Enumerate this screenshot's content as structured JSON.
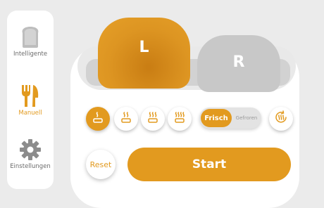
{
  "colors": {
    "accent": "#e29a1f",
    "inactive_bread": "#c8c8c8",
    "background": "#ebebeb",
    "icon_gray": "#8c8c8c"
  },
  "sidebar": {
    "items": [
      {
        "label": "Intelligente",
        "icon": "bread-slice-icon",
        "active": false
      },
      {
        "label": "Manuell",
        "icon": "fork-knife-icon",
        "active": true
      },
      {
        "label": "Einstellungen",
        "icon": "gear-icon",
        "active": false
      }
    ]
  },
  "slots": {
    "left": {
      "label": "L",
      "active": true
    },
    "right": {
      "label": "R",
      "active": false
    }
  },
  "browning_levels": [
    {
      "level": 1,
      "icon": "toast-level-1-icon",
      "selected": true
    },
    {
      "level": 2,
      "icon": "toast-level-2-icon",
      "selected": false
    },
    {
      "level": 3,
      "icon": "toast-level-3-icon",
      "selected": false
    },
    {
      "level": 4,
      "icon": "toast-level-4-icon",
      "selected": false
    }
  ],
  "mode_toggle": {
    "on_label": "Frisch",
    "off_label": "Gefroren",
    "selected": "Frisch"
  },
  "reheat_icon": "reheat-icon",
  "actions": {
    "reset_label": "Reset",
    "start_label": "Start"
  }
}
